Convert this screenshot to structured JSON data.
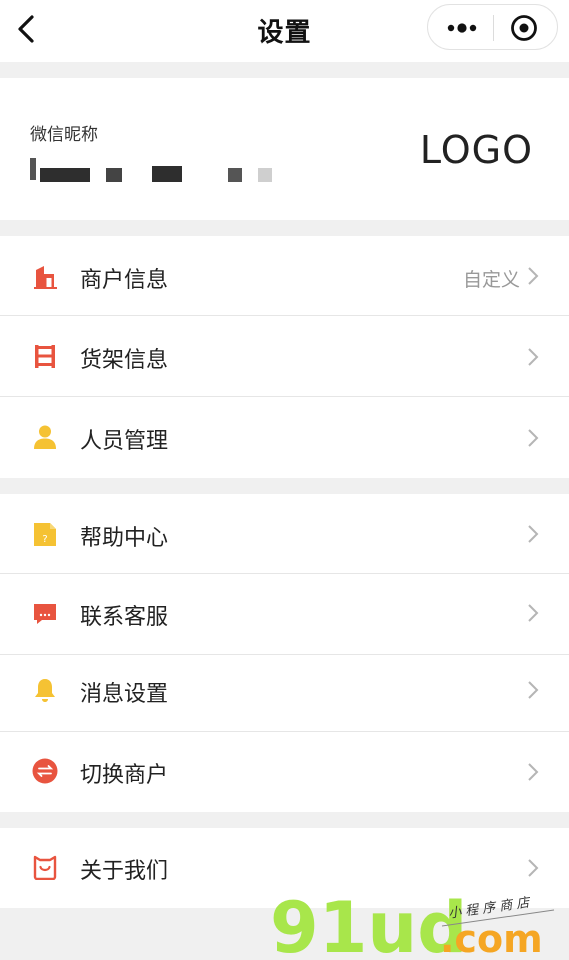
{
  "nav": {
    "title": "设置"
  },
  "profile": {
    "nickname_label": "微信昵称",
    "logo_text": "LOGO"
  },
  "groups": [
    {
      "items": [
        {
          "label": "商户信息",
          "extra": "自定义",
          "icon": "store-icon"
        },
        {
          "label": "货架信息",
          "extra": "",
          "icon": "shelf-icon"
        },
        {
          "label": "人员管理",
          "extra": "",
          "icon": "person-icon"
        }
      ]
    },
    {
      "items": [
        {
          "label": "帮助中心",
          "extra": "",
          "icon": "help-doc-icon"
        },
        {
          "label": "联系客服",
          "extra": "",
          "icon": "chat-icon"
        },
        {
          "label": "消息设置",
          "extra": "",
          "icon": "bell-icon"
        },
        {
          "label": "切换商户",
          "extra": "",
          "icon": "switch-icon"
        }
      ]
    },
    {
      "items": [
        {
          "label": "关于我们",
          "extra": "",
          "icon": "about-bag-icon"
        }
      ]
    }
  ],
  "watermark": {
    "main": "91ud",
    "suffix": ".com",
    "tagline": "小 程 序 商 店"
  },
  "colors": {
    "accent_red": "#e8543f",
    "accent_yellow": "#f5c233",
    "divider": "#e6e6e6",
    "page_bg": "#f0f0f0"
  }
}
